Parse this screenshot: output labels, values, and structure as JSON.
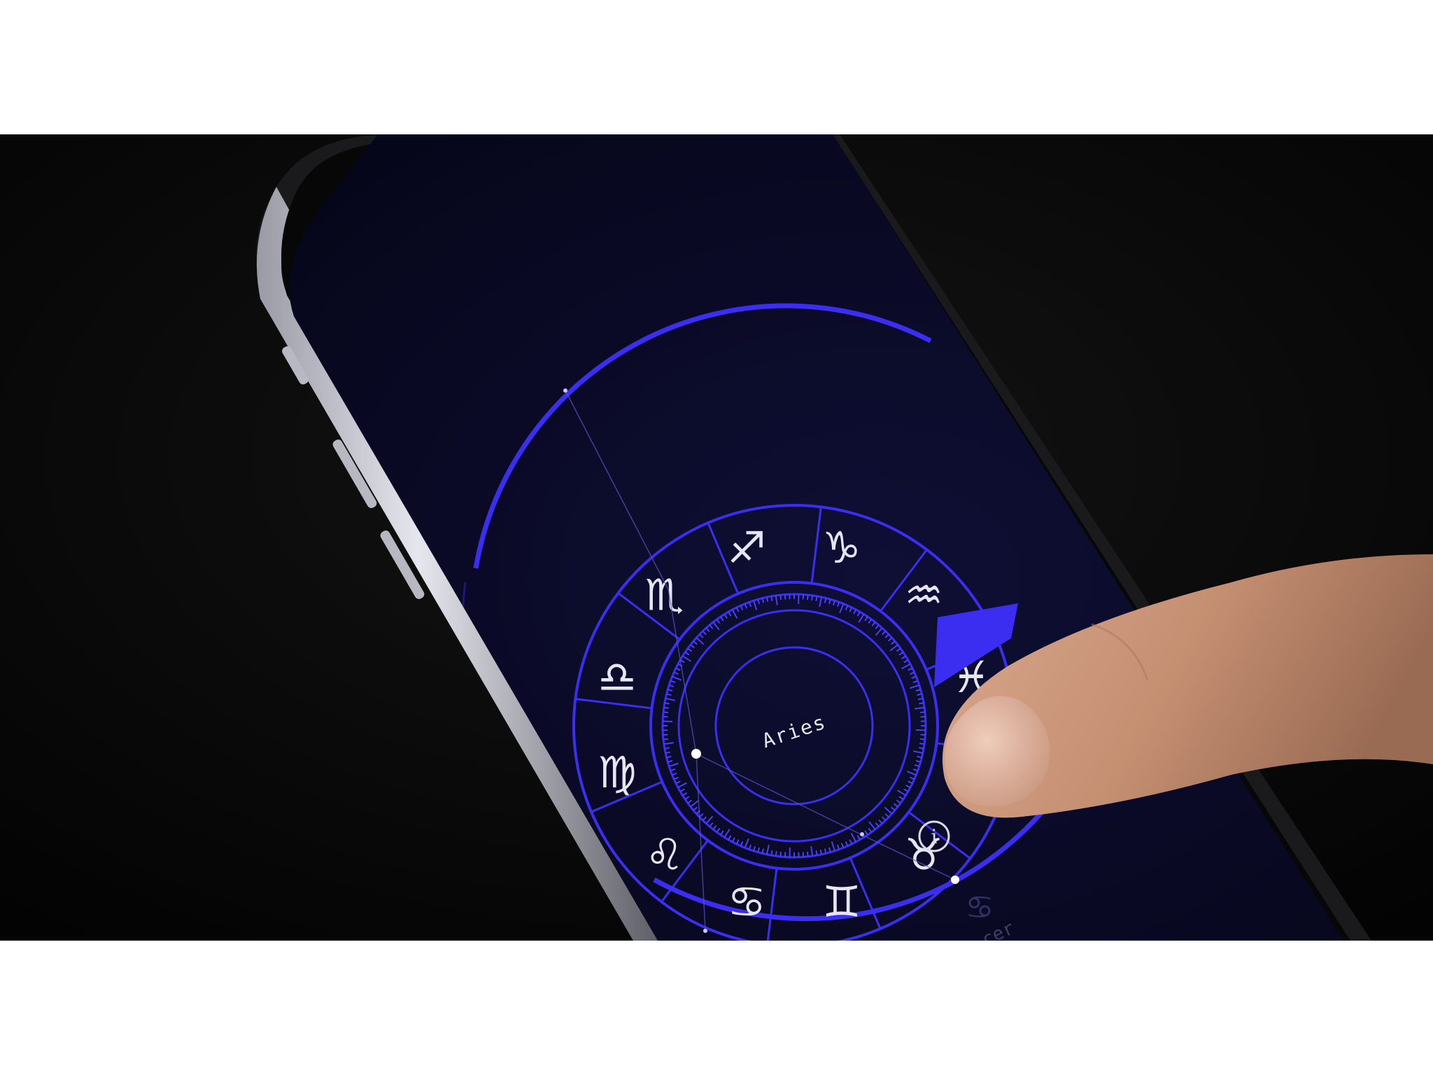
{
  "scene": {
    "subject": "phone",
    "app_theme_colors": {
      "background": "#0b0b2e",
      "ring": "#3b2ef0",
      "glyph": "#e6e6f2"
    }
  },
  "zodiac_wheel": {
    "center_label": "Aries",
    "signs": [
      {
        "name": "sagittarius",
        "glyph": "♐"
      },
      {
        "name": "capricorn",
        "glyph": "♑"
      },
      {
        "name": "aquarius",
        "glyph": "♒"
      },
      {
        "name": "pisces",
        "glyph": "♓"
      },
      {
        "name": "taurus",
        "glyph": "♉"
      },
      {
        "name": "gemini",
        "glyph": "♊"
      },
      {
        "name": "cancer",
        "glyph": "♋"
      },
      {
        "name": "leo",
        "glyph": "♌"
      },
      {
        "name": "virgo",
        "glyph": "♍"
      },
      {
        "name": "libra",
        "glyph": "♎"
      },
      {
        "name": "scorpio",
        "glyph": "♏"
      }
    ],
    "info_button_glyph": "i",
    "partial_bottom_glyph": "♋",
    "partial_bottom_label": "cer"
  }
}
